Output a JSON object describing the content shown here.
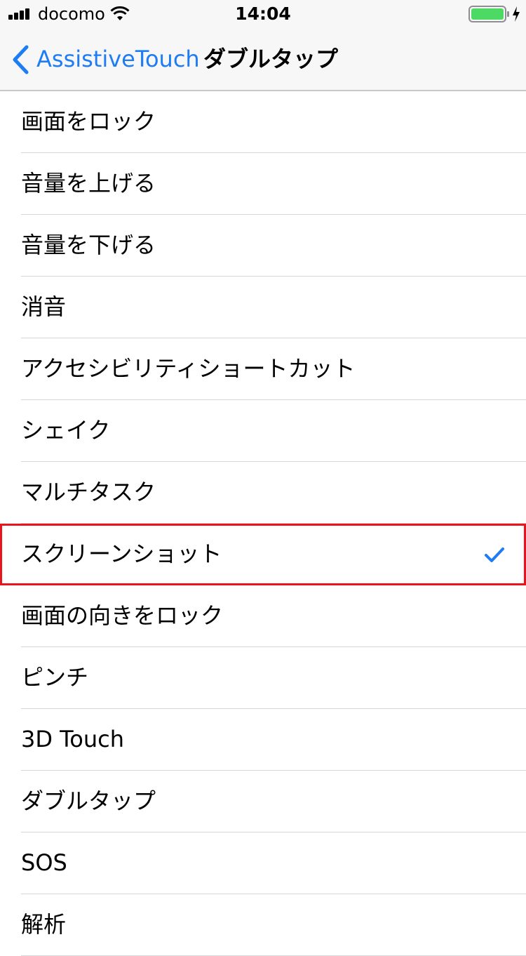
{
  "status_bar": {
    "carrier": "docomo",
    "time": "14:04",
    "battery_color": "#4cd964",
    "icons": [
      "signal-icon",
      "wifi-icon",
      "battery-icon",
      "charging-icon"
    ]
  },
  "nav": {
    "back_label": "AssistiveTouch",
    "title": "ダブルタップ",
    "accent_color": "#1e7cf4"
  },
  "list": {
    "items": [
      {
        "label": "画面をロック",
        "selected": false
      },
      {
        "label": "音量を上げる",
        "selected": false
      },
      {
        "label": "音量を下げる",
        "selected": false
      },
      {
        "label": "消音",
        "selected": false
      },
      {
        "label": "アクセシビリティショートカット",
        "selected": false
      },
      {
        "label": "シェイク",
        "selected": false
      },
      {
        "label": "マルチタスク",
        "selected": false
      },
      {
        "label": "スクリーンショット",
        "selected": true
      },
      {
        "label": "画面の向きをロック",
        "selected": false
      },
      {
        "label": "ピンチ",
        "selected": false
      },
      {
        "label": "3D Touch",
        "selected": false
      },
      {
        "label": "ダブルタップ",
        "selected": false
      },
      {
        "label": "SOS",
        "selected": false
      },
      {
        "label": "解析",
        "selected": false
      }
    ],
    "highlight_color": "#e8151b",
    "check_icon": "checkmark-icon"
  }
}
